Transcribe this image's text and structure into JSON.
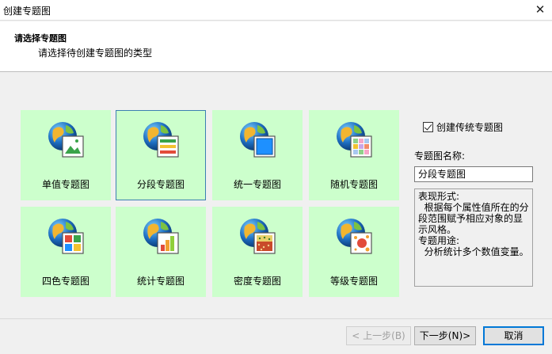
{
  "window": {
    "title": "创建专题图",
    "close_glyph": "✕"
  },
  "header": {
    "title": "请选择专题图",
    "subtitle": "请选择待创建专题图的类型"
  },
  "tiles": [
    {
      "label": "单值专题图",
      "icon": "globe-image-icon"
    },
    {
      "label": "分段专题图",
      "icon": "globe-range-icon",
      "selected": true
    },
    {
      "label": "统一专题图",
      "icon": "globe-unified-icon"
    },
    {
      "label": "随机专题图",
      "icon": "globe-random-icon"
    },
    {
      "label": "四色专题图",
      "icon": "globe-four-color-icon"
    },
    {
      "label": "统计专题图",
      "icon": "globe-statistics-icon"
    },
    {
      "label": "密度专题图",
      "icon": "globe-density-icon"
    },
    {
      "label": "等级专题图",
      "icon": "globe-graduated-icon"
    }
  ],
  "options": {
    "create_traditional_label": "创建传统专题图",
    "create_traditional_checked": true,
    "name_label": "专题图名称:",
    "name_value": "分段专题图"
  },
  "description": {
    "form_heading": "表现形式:",
    "form_text": "  根据每个属性值所在的分段范围赋予相应对象的显示风格。",
    "use_heading": "专题用途:",
    "use_text": "  分析统计多个数值变量。"
  },
  "buttons": {
    "prev": "< 上一步(B)",
    "next": "下一步(N)>",
    "cancel": "取消"
  },
  "colors": {
    "tile_bg": "#ccffcc",
    "selected_border": "#3c7fb1",
    "accent": "#0078d7"
  }
}
